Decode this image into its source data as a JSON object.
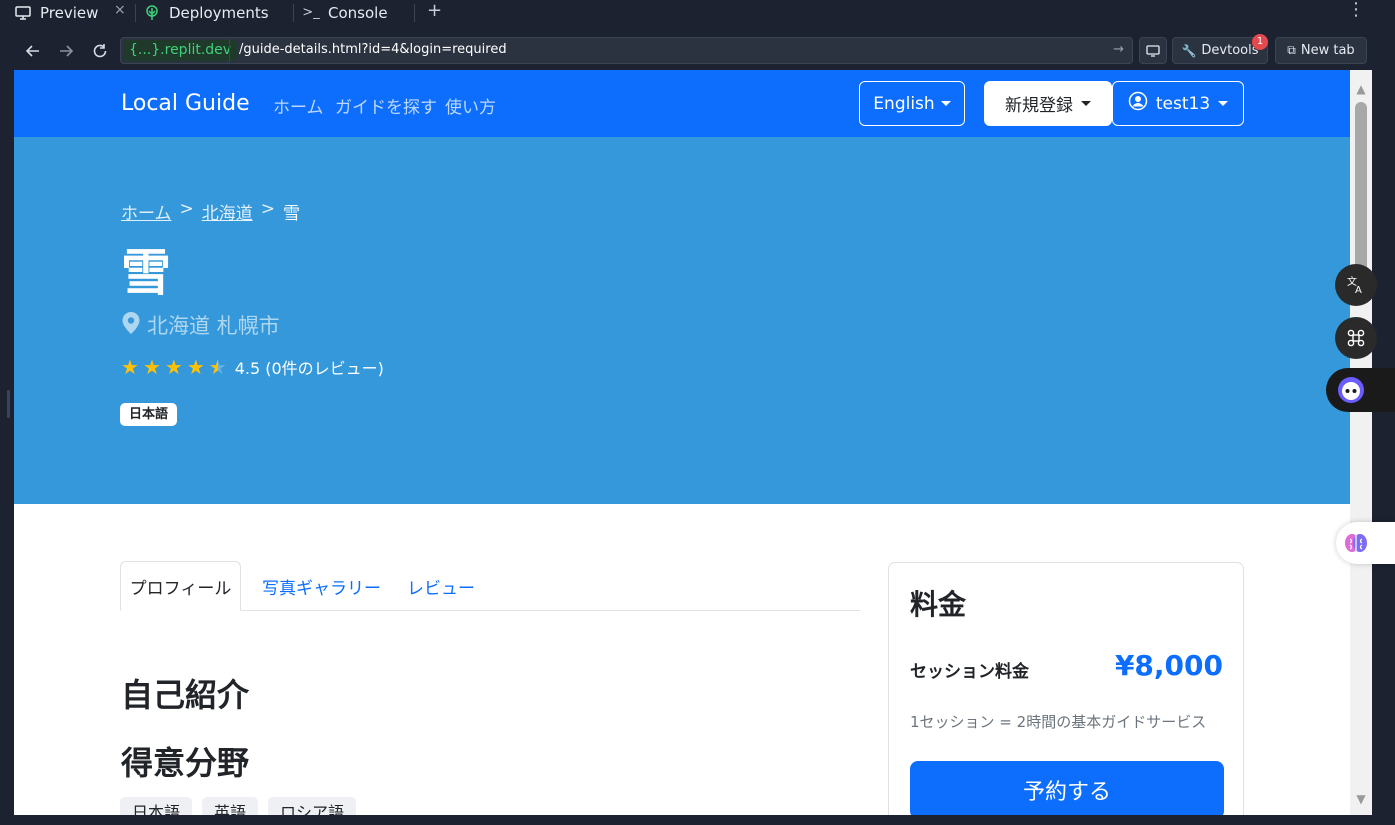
{
  "workspace": {
    "tabs": [
      {
        "label": "Preview"
      },
      {
        "label": "Deployments"
      },
      {
        "label": "Console"
      }
    ],
    "close_glyph": "×",
    "add_glyph": "+",
    "more_glyph": "⋮"
  },
  "addressbar": {
    "domain": "{...}.replit.dev",
    "path": "/guide-details.html?id=4&login=required",
    "devtools_label": "Devtools",
    "devtools_badge": "1",
    "newtab_label": "New tab"
  },
  "site": {
    "brand": "Local Guide",
    "nav": [
      "ホーム",
      "ガイドを探す",
      "使い方"
    ],
    "language_button": "English",
    "register_button": "新規登録",
    "user_button": "test13",
    "accent_color": "#0d6efd",
    "hero_color": "#3498db"
  },
  "hero": {
    "breadcrumb": {
      "home": "ホーム",
      "region": "北海道",
      "current": "雪",
      "separator": ">"
    },
    "guide_name": "雪",
    "location": "北海道 札幌市",
    "rating_value": 4.5,
    "rating_text": "4.5 (0件のレビュー)",
    "languages": [
      "日本語"
    ]
  },
  "profile_tabs": [
    "プロフィール",
    "写真ギャラリー",
    "レビュー"
  ],
  "profile": {
    "intro_heading": "自己紹介",
    "specialty_heading": "得意分野",
    "specialties": [
      "日本語",
      "英語",
      "ロシア語"
    ]
  },
  "pricing": {
    "title": "料金",
    "session_label": "セッション料金",
    "session_price": "¥8,000",
    "note": "1セッション = 2時間の基本ガイドサービス",
    "book_button": "予約する"
  },
  "icons": {
    "preview": "monitor-icon",
    "deployments": "deploy-tree-icon",
    "console": "terminal-icon",
    "location": "map-pin-icon",
    "user": "user-circle-icon"
  }
}
